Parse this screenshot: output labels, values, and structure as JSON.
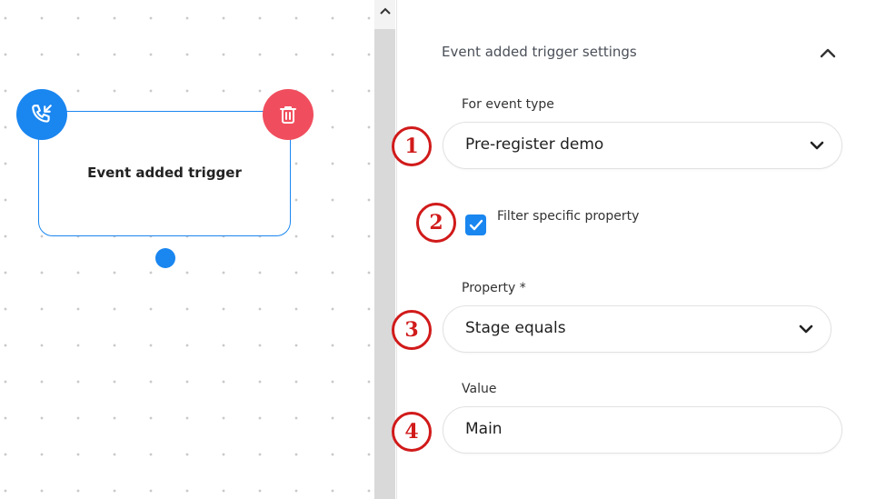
{
  "canvas": {
    "node": {
      "title": "Event added trigger",
      "left_icon": "phone-incoming-icon",
      "right_icon": "trash-icon"
    }
  },
  "panel": {
    "title": "Event added trigger settings",
    "collapse_icon": "chevron-up-icon",
    "event_type": {
      "label": "For event type",
      "value": "Pre-register demo"
    },
    "filter": {
      "label": "Filter specific property",
      "checked": true
    },
    "property": {
      "label": "Property *",
      "value": "Stage equals"
    },
    "value_field": {
      "label": "Value",
      "value": "Main"
    }
  },
  "annotations": [
    "1",
    "2",
    "3",
    "4"
  ],
  "colors": {
    "accent": "#1a86f0",
    "danger": "#f04e5e",
    "annotation": "#d11a1a"
  }
}
